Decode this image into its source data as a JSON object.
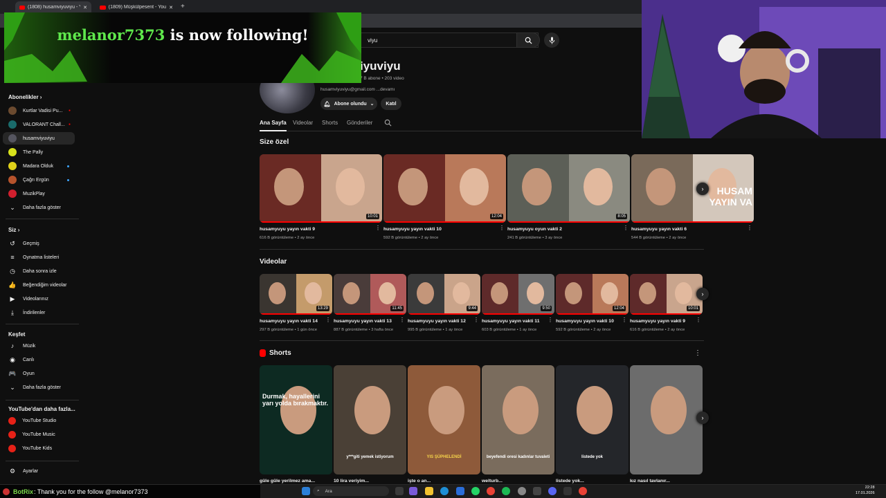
{
  "browser": {
    "tabs": [
      {
        "label": "(1808) husamviyuviyu - YouTube",
        "active": true
      },
      {
        "label": "(1809) Müşkülpesent - YouTube",
        "active": false
      }
    ]
  },
  "header": {
    "search_value": "viyu"
  },
  "follow_alert": {
    "name": "melanor7373",
    "text": " is now following!"
  },
  "sidebar": {
    "subs_title": "Abonelikler",
    "subs": [
      {
        "label": "Kurtlar Vadisi Pu...",
        "color": "#6b4a2f",
        "badge": "live"
      },
      {
        "label": "VALORANT Chall...",
        "color": "#1a6b6b",
        "badge": "live"
      },
      {
        "label": "husamviyuviyu",
        "color": "#55555f",
        "badge": "",
        "selected": true
      },
      {
        "label": "The Pally",
        "color": "#d8e21c",
        "badge": ""
      },
      {
        "label": "Madara Olduk",
        "color": "#e0d11a",
        "badge": "dot"
      },
      {
        "label": "Çağrı Ergün",
        "color": "#b6532c",
        "badge": "dot"
      },
      {
        "label": "MuzikPlay",
        "color": "#d11f2e",
        "badge": ""
      }
    ],
    "subs_more": "Daha fazla göster",
    "you_title": "Siz",
    "you_items": [
      {
        "label": "Geçmiş",
        "icon": "history-icon",
        "glyph": "↺"
      },
      {
        "label": "Oynatma listeleri",
        "icon": "playlist-icon",
        "glyph": "≡"
      },
      {
        "label": "Daha sonra izle",
        "icon": "clock-icon",
        "glyph": "◷"
      },
      {
        "label": "Beğendiğim videolar",
        "icon": "thumbs-up-icon",
        "glyph": "👍"
      },
      {
        "label": "Videolarınız",
        "icon": "video-icon",
        "glyph": "▶"
      },
      {
        "label": "İndirilenler",
        "icon": "download-icon",
        "glyph": "⤓"
      }
    ],
    "explore_title": "Keşfet",
    "explore_items": [
      {
        "label": "Müzik",
        "icon": "music-icon",
        "glyph": "♪"
      },
      {
        "label": "Canlı",
        "icon": "live-icon",
        "glyph": "◉"
      },
      {
        "label": "Oyun",
        "icon": "gamepad-icon",
        "glyph": "🎮"
      },
      {
        "label": "Daha fazla göster",
        "icon": "chevron-down-icon",
        "glyph": "⌄"
      }
    ],
    "more_title": "YouTube'dan daha fazla...",
    "more_items": [
      {
        "label": "YouTube Studio"
      },
      {
        "label": "YouTube Music"
      },
      {
        "label": "YouTube Kids"
      }
    ],
    "settings": "Ayarlar"
  },
  "channel": {
    "name": "husamviyuviyu",
    "name_visible": "iyuviyu",
    "meta": "7 B abone • 203 video",
    "desc": "husamviyuviyu@gmail.com ...devamı",
    "subscribed_label": "Abone olundu",
    "join_label": "Katıl",
    "tabs": [
      "Ana Sayfa",
      "Videolar",
      "Shorts",
      "Gönderiler"
    ]
  },
  "for_you": {
    "title": "Size özel",
    "items": [
      {
        "title": "husamyuyu yayın vakti 9",
        "meta": "616 B görüntüleme • 2 ay önce",
        "duration": "10:01",
        "c1": "#6a2a24",
        "c2": "#c9a58d"
      },
      {
        "title": "husamyuyu yayın vakti 10",
        "meta": "592 B görüntüleme • 2 ay önce",
        "duration": "12:04",
        "c1": "#6a2a24",
        "c2": "#b9795a"
      },
      {
        "title": "husamyuyu oyun vakti 2",
        "meta": "241 B görüntüleme • 3 ay önce",
        "duration": "8:05",
        "c1": "#5c5f57",
        "c2": "#8a8a80"
      },
      {
        "title": "husamyuyu yayın vakti 6",
        "meta": "544 B görüntüleme • 2 ay önce",
        "duration": "",
        "c1": "#7a6a5a",
        "c2": "#d3c7bb",
        "overlay": "HUSAM\nYAYIN VA"
      }
    ]
  },
  "videos": {
    "title": "Videolar",
    "items": [
      {
        "title": "husamyuyu yayın vakti 14",
        "meta": "297 B görüntüleme • 1 gün önce",
        "duration": "13:29",
        "c1": "#3a3530",
        "c2": "#c49b6b"
      },
      {
        "title": "husamyuyu yayın vakti 13",
        "meta": "887 B görüntüleme • 3 hafta önce",
        "duration": "11:45",
        "c1": "#4a3c3a",
        "c2": "#b05a5a"
      },
      {
        "title": "husamyuyu yayın vakti 12",
        "meta": "995 B görüntüleme • 1 ay önce",
        "duration": "9:44",
        "c1": "#3b3b3b",
        "c2": "#caa48a"
      },
      {
        "title": "husamyuyu yayın vakti 11",
        "meta": "603 B görüntüleme • 1 ay önce",
        "duration": "9:50",
        "c1": "#5e2a2a",
        "c2": "#6f6f6f"
      },
      {
        "title": "husamyuyu yayın vakti 10",
        "meta": "592 B görüntüleme • 2 ay önce",
        "duration": "12:04",
        "c1": "#5e2a2a",
        "c2": "#b9795a"
      },
      {
        "title": "husamyuyu yayın vakti 9",
        "meta": "616 B görüntüleme • 2 ay önce",
        "duration": "10:01",
        "c1": "#5e2a2a",
        "c2": "#c9a58d"
      }
    ]
  },
  "shorts": {
    "title": "Shorts",
    "items": [
      {
        "title": "güle güle yerilmez ama...",
        "caption": "Durmak, hayallerini yarı yolda bırakmaktır.",
        "bg": "#0d2a22"
      },
      {
        "title": "10 lira veriyim...",
        "caption": "y***giti yemek istiyorum",
        "bg": "#4a4036"
      },
      {
        "title": "işte o an...",
        "caption": "YIS ŞÜPHELENDİ",
        "bg": "#8e5a3a"
      },
      {
        "title": "welturb...",
        "caption": "beyefendi oresi kadınlar tuvaleti",
        "bg": "#7a6c5d"
      },
      {
        "title": "listede yok...",
        "caption": "listede yok",
        "bg": "#24262a"
      },
      {
        "title": "kız nasıl tavlanır...",
        "caption": "",
        "bg": "#6c6c6c"
      }
    ]
  },
  "taskbar": {
    "chat_user": "BotRix",
    "chat_msg": ": Thank you for the follow @melanor7373",
    "search_placeholder": "Ara",
    "time": "22:28",
    "date": "17.01.2026"
  }
}
